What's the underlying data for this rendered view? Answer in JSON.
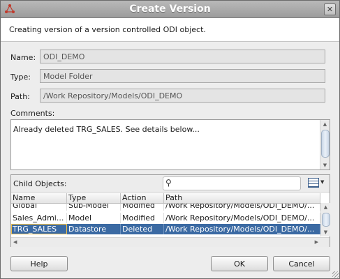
{
  "window": {
    "title": "Create Version",
    "close_glyph": "✕"
  },
  "header": {
    "text": "Creating version of a version controlled ODI object."
  },
  "form": {
    "name_label": "Name:",
    "name_value": "ODI_DEMO",
    "type_label": "Type:",
    "type_value": "Model Folder",
    "path_label": "Path:",
    "path_value": "/Work Repository/Models/ODI_DEMO",
    "comments_label": "Comments:",
    "comments_value": "Already deleted TRG_SALES. See details below..."
  },
  "child_objects": {
    "label": "Child Objects:",
    "search_placeholder": "",
    "columns": [
      "Name",
      "Type",
      "Action",
      "Path"
    ],
    "rows": [
      {
        "name": "Global",
        "type": "Sub-Model",
        "action": "Modified",
        "path": "/Work Repository/Models/ODI_DEMO/..."
      },
      {
        "name": "Sales_Admi...",
        "type": "Model",
        "action": "Modified",
        "path": "/Work Repository/Models/ODI_DEMO/..."
      },
      {
        "name": "TRG_SALES",
        "type": "Datastore",
        "action": "Deleted",
        "path": "/Work Repository/Models/ODI_DEMO/..."
      }
    ],
    "selected_row": 2
  },
  "buttons": {
    "help": "Help",
    "ok": "OK",
    "cancel": "Cancel"
  },
  "colors": {
    "selection": "#3b6aa3",
    "title_bar": "#a9a9a9",
    "header_bg": "#ffffff"
  },
  "icons": [
    "odi-app-icon",
    "close-icon",
    "search-icon",
    "table-columns-icon"
  ]
}
